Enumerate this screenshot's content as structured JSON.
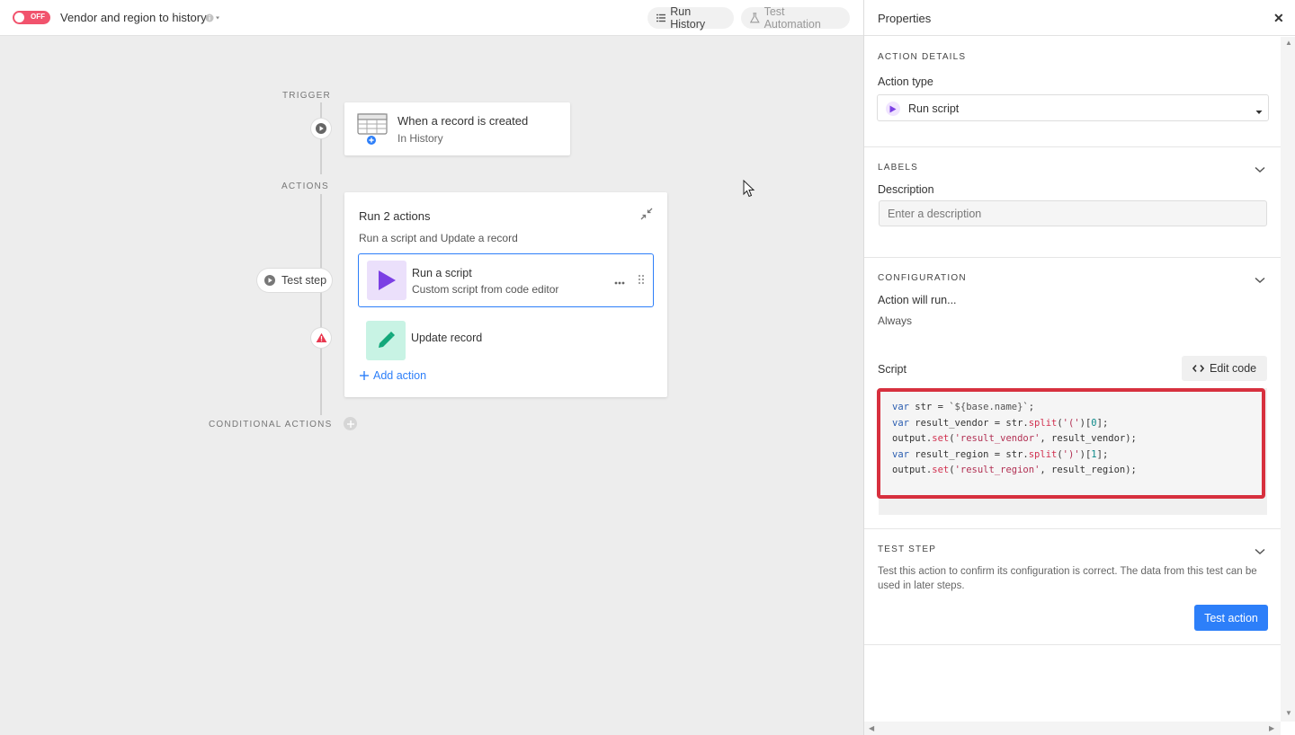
{
  "topbar": {
    "toggle_label": "OFF",
    "title": "Vendor and region to history",
    "run_history": "Run History",
    "test_automation": "Test Automation"
  },
  "canvas": {
    "trigger_label": "TRIGGER",
    "actions_label": "ACTIONS",
    "conditional_label": "CONDITIONAL ACTIONS",
    "trigger": {
      "title": "When a record is created",
      "subtitle": "In History"
    },
    "group": {
      "title": "Run 2 actions",
      "subtitle": "Run a script and Update a record"
    },
    "steps": [
      {
        "title": "Run a script",
        "subtitle": "Custom script from code editor"
      },
      {
        "title": "Update record",
        "subtitle": ""
      }
    ],
    "add_action": "Add action",
    "test_step": "Test step"
  },
  "panel": {
    "title": "Properties",
    "action_details": "ACTION DETAILS",
    "action_type_label": "Action type",
    "action_type_value": "Run script",
    "labels_section": "LABELS",
    "description_label": "Description",
    "description_placeholder": "Enter a description",
    "configuration_section": "CONFIGURATION",
    "action_will_run": "Action will run...",
    "run_condition": "Always",
    "script_label": "Script",
    "edit_code": "Edit code",
    "test_step_section": "TEST STEP",
    "test_description": "Test this action to confirm its configuration is correct. The data from this test can be used in later steps.",
    "test_action": "Test action"
  },
  "colors": {
    "accent": "#2d7ff9",
    "toggle_off": "#f1536d",
    "highlight_border": "#d7303e",
    "script_purple": "#7b3fe4",
    "update_teal": "#20c997",
    "warning": "#e8384f"
  }
}
